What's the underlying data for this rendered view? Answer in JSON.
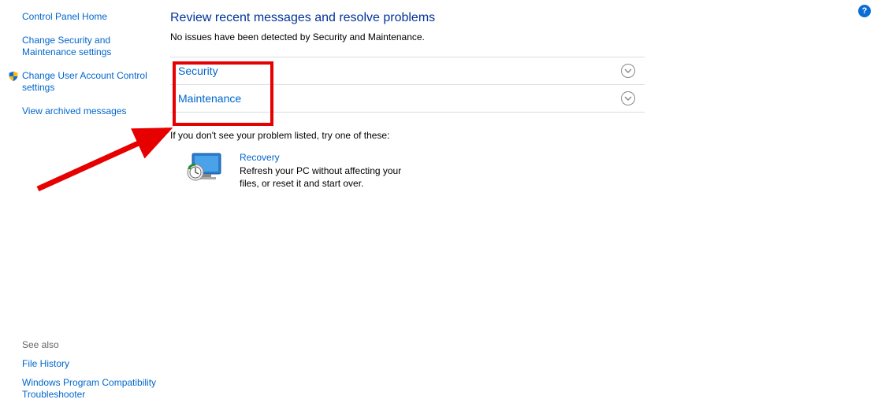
{
  "sidebar": {
    "home": "Control Panel Home",
    "links": [
      "Change Security and Maintenance settings",
      "Change User Account Control settings",
      "View archived messages"
    ],
    "see_also_heading": "See also",
    "see_also": [
      "File History",
      "Windows Program Compatibility Troubleshooter"
    ]
  },
  "main": {
    "title": "Review recent messages and resolve problems",
    "status": "No issues have been detected by Security and Maintenance.",
    "expanders": [
      {
        "label": "Security"
      },
      {
        "label": "Maintenance"
      }
    ],
    "subhead": "If you don't see your problem listed, try one of these:",
    "recovery": {
      "title": "Recovery",
      "desc": "Refresh your PC without affecting your files, or reset it and start over."
    }
  },
  "help_badge": "?"
}
